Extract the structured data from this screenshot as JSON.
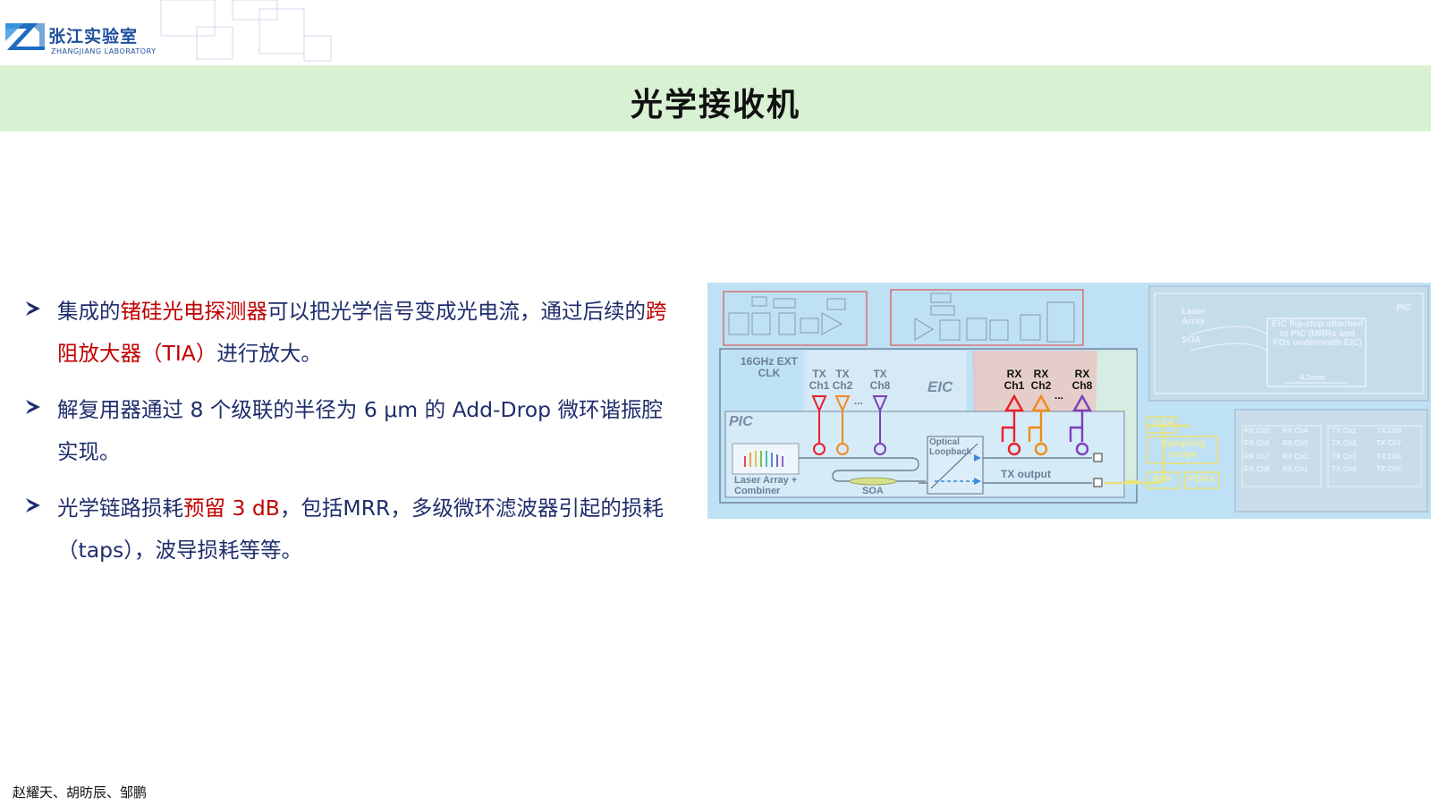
{
  "header": {
    "logo_cn": "张江实验室",
    "logo_en": "ZHANGJIANG  LABORATORY",
    "title": "光学接收机"
  },
  "bullets": [
    {
      "segments": [
        {
          "text": "集成的",
          "highlight": false
        },
        {
          "text": "锗硅光电探测器",
          "highlight": true
        },
        {
          "text": "可以把光学信号变成光电流，通过后续的",
          "highlight": false
        },
        {
          "text": "跨阻放大器（TIA）",
          "highlight": true
        },
        {
          "text": "进行放大。",
          "highlight": false
        }
      ]
    },
    {
      "segments": [
        {
          "text": "解复用器通过 8 个级联的半径为 6 μm 的 Add-Drop 微环谐振腔实现。",
          "highlight": false
        }
      ]
    },
    {
      "segments": [
        {
          "text": "光学链路损耗",
          "highlight": false
        },
        {
          "text": "预留 3 dB",
          "highlight": true
        },
        {
          "text": "，包括MRR，多级微环滤波器引起的损耗（taps），波导损耗等等。",
          "highlight": false
        }
      ]
    }
  ],
  "figure": {
    "clk_label": "16GHz EXT CLK",
    "eic_label": "EIC",
    "pic_label": "PIC",
    "tx_ch1": "TX Ch1",
    "tx_ch2": "TX Ch2",
    "tx_ch8": "TX Ch8",
    "rx_ch1": "RX Ch1",
    "rx_ch2": "RX Ch2",
    "rx_ch8": "RX Ch8",
    "ellipsis": "...",
    "optical_loopback": "Optical Loopback",
    "tx_output": "TX output",
    "laser_array": "Laser Array + Combiner",
    "soa": "SOA",
    "osa": "OSA",
    "sampling_scope": "Sampling scope",
    "bpf": "BPF",
    "pdfa": "PDFA",
    "chip_laser_array": "Laser Array",
    "chip_soa": "SOA",
    "chip_pic": "PIC",
    "eic_flip_chip": "EIC flip-chip attached to PIC (MRRs and PDs underneath EIC)",
    "chip_size": "4.2mm",
    "grid_left": [
      "RX Ch5",
      "RX Ch4",
      "RX Ch6",
      "RX Ch3",
      "RX Ch7",
      "RX Ch2",
      "RX Ch8",
      "RX Ch1"
    ],
    "grid_right": [
      "TX Ch1",
      "TX Ch8",
      "TX Ch2",
      "TX Ch7",
      "TX Ch3",
      "TX Ch6",
      "TX Ch4",
      "TX Ch5"
    ],
    "colors": {
      "ch1": "#e8202a",
      "ch2": "#f08a1c",
      "ch8": "#7b3fb8",
      "background": "#bfe1f5"
    }
  },
  "footer": {
    "authors": "赵耀天、胡昉辰、邹鹏"
  }
}
